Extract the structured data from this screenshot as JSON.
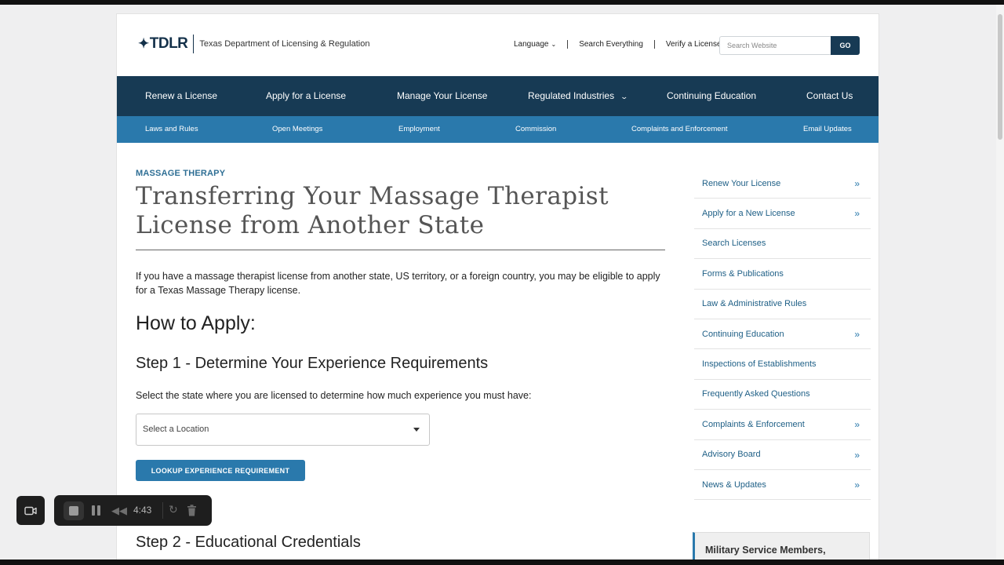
{
  "header": {
    "logo_text": "TDLR",
    "agency_name": "Texas Department of Licensing & Regulation",
    "utility_links": {
      "language": "Language",
      "search_everything": "Search Everything",
      "verify_license": "Verify a License"
    },
    "search": {
      "placeholder": "Search Website",
      "button": "GO"
    }
  },
  "main_nav": {
    "renew": "Renew a License",
    "apply": "Apply for a License",
    "manage": "Manage Your License",
    "industries": "Regulated Industries",
    "ce": "Continuing Education",
    "contact": "Contact Us"
  },
  "sub_nav": {
    "laws": "Laws and Rules",
    "meetings": "Open Meetings",
    "employment": "Employment",
    "commission": "Commission",
    "complaints": "Complaints and Enforcement",
    "email": "Email Updates"
  },
  "content": {
    "eyebrow": "MASSAGE THERAPY",
    "title": "Transferring Your Massage Therapist License from Another State",
    "intro": "If you have a massage therapist license from another state, US territory, or a foreign country, you may be eligible to apply for a Texas Massage Therapy license.",
    "how_to_apply": "How to Apply:",
    "step1_heading": "Step 1 - Determine Your Experience Requirements",
    "step1_instruction": "Select the state where you are licensed to determine how much experience you must have:",
    "location_select": "Select a Location",
    "lookup_button": "LOOKUP EXPERIENCE REQUIREMENT",
    "step2_heading": "Step 2 - Educational Credentials"
  },
  "sidebar": {
    "items": [
      {
        "label": "Renew Your License",
        "arrow": "»"
      },
      {
        "label": "Apply for a New License",
        "arrow": "»"
      },
      {
        "label": "Search Licenses",
        "arrow": ""
      },
      {
        "label": "Forms & Publications",
        "arrow": ""
      },
      {
        "label": "Law & Administrative Rules",
        "arrow": ""
      },
      {
        "label": "Continuing Education",
        "arrow": "»"
      },
      {
        "label": "Inspections of Establishments",
        "arrow": ""
      },
      {
        "label": "Frequently Asked Questions",
        "arrow": ""
      },
      {
        "label": "Complaints & Enforcement",
        "arrow": "»"
      },
      {
        "label": "Advisory Board",
        "arrow": "»"
      },
      {
        "label": "News & Updates",
        "arrow": "»"
      }
    ],
    "military_box": "Military Service Members,"
  },
  "recorder": {
    "elapsed": "4:43",
    "icons": [
      "camera-icon",
      "stop-icon",
      "pause-icon",
      "rewind-icon",
      "restart-icon",
      "trash-icon"
    ]
  },
  "colors": {
    "nav_dark": "#173a54",
    "nav_light": "#2a79ac",
    "link": "#1e5f86"
  }
}
